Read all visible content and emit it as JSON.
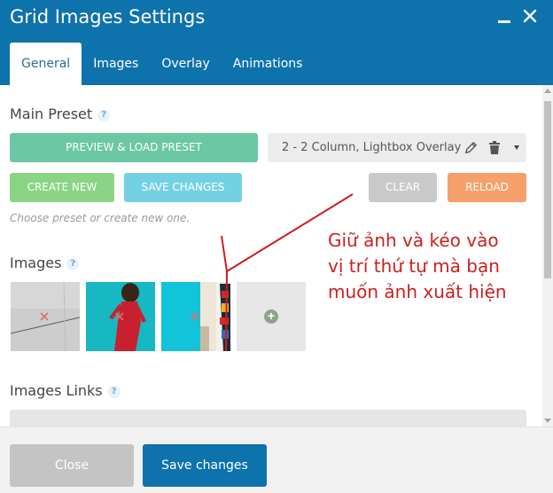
{
  "window": {
    "title": "Grid Images Settings"
  },
  "tabs": [
    {
      "label": "General",
      "active": true
    },
    {
      "label": "Images"
    },
    {
      "label": "Overlay"
    },
    {
      "label": "Animations"
    }
  ],
  "main_preset": {
    "label": "Main Preset",
    "help": "?",
    "preview_button": "PREVIEW & LOAD PRESET",
    "selected_preset": "2 - 2 Column, Lightbox Overlay",
    "create_button": "CREATE NEW",
    "save_button": "SAVE CHANGES",
    "clear_button": "CLEAR",
    "reload_button": "RELOAD",
    "hint": "Choose preset or create new one."
  },
  "images": {
    "label": "Images",
    "help": "?",
    "thumbnails": [
      {
        "icon": "remove-icon"
      },
      {
        "icon": "remove-icon"
      },
      {
        "icon": "remove-icon"
      }
    ],
    "add_icon": "plus-icon"
  },
  "images_links": {
    "label": "Images Links",
    "help": "?"
  },
  "annotation": {
    "lines": [
      "Giữ ảnh và kéo vào",
      "vị trí thứ tự mà bạn",
      "muốn ảnh xuất hiện"
    ]
  },
  "footer": {
    "close_button": "Close",
    "save_button": "Save changes"
  },
  "colors": {
    "header": "#0e72ac",
    "preview": "#6cc7a4",
    "create": "#8ad486",
    "save": "#74d1e3",
    "clear": "#c9c9c9",
    "reload": "#f5a06a",
    "annotation": "#cc1f1f"
  }
}
